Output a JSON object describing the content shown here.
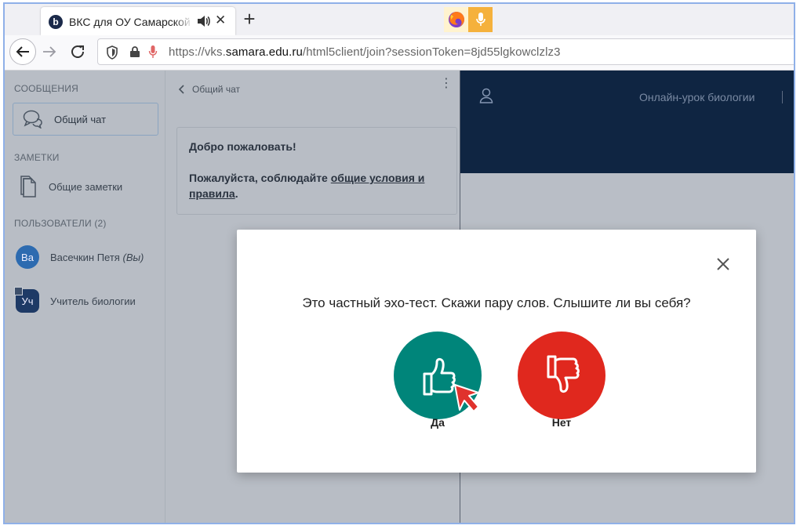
{
  "browser": {
    "tab": {
      "title": "ВКС для ОУ Самарской области",
      "favicon_letter": "b",
      "close_glyph": "✕"
    },
    "new_tab_glyph": "+",
    "url": {
      "prefix": "https://vks.",
      "domain": "samara.edu.ru",
      "path": "/html5client/join?sessionToken=8jd55lgkowclzlz3"
    }
  },
  "sidebar": {
    "messages_header": "СООБЩЕНИЯ",
    "public_chat": "Общий чат",
    "notes_header": "ЗАМЕТКИ",
    "shared_notes": "Общие заметки",
    "users_header": "ПОЛЬЗОВАТЕЛИ (2)",
    "users": [
      {
        "initials": "Ва",
        "name": "Васечкин Петя",
        "suffix": "(Вы)",
        "color": "#2d6bb0"
      },
      {
        "initials": "Уч",
        "name": "Учитель биологии",
        "suffix": "",
        "color": "#1e3a66"
      }
    ]
  },
  "chat": {
    "header": "Общий чат",
    "menu_glyph": "⋮",
    "welcome_title": "Добро пожаловать!",
    "welcome_text": "Пожалуйста, соблюдайте ",
    "welcome_link": "общие условия и правила",
    "welcome_end": "."
  },
  "main": {
    "title": "Онлайн-урок биологии"
  },
  "modal": {
    "question": "Это частный эхо-тест. Скажи пару слов.  Слышите ли вы себя?",
    "yes_label": "Да",
    "no_label": "Нет",
    "yes_color": "#00857a",
    "no_color": "#e0281e"
  }
}
